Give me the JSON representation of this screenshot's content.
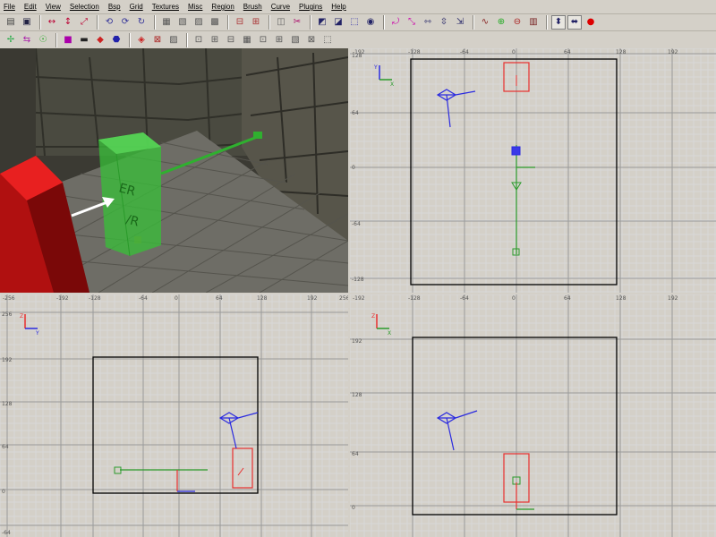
{
  "menu": [
    "File",
    "Edit",
    "View",
    "Selection",
    "Bsp",
    "Grid",
    "Textures",
    "Misc",
    "Region",
    "Brush",
    "Curve",
    "Plugins",
    "Help"
  ],
  "toolbar1_icons": [
    "open-file-icon",
    "save-icon",
    "flip-x-icon",
    "flip-y-icon",
    "flip-z-icon",
    "rotate-x-icon",
    "rotate-y-icon",
    "rotate-z-icon",
    "select-complete-icon",
    "select-touching-icon",
    "select-partial-icon",
    "select-inside-icon",
    "csg-subtract-icon",
    "csg-merge-icon",
    "hollow-icon",
    "clipper-icon",
    "change-view-icon",
    "texture-view-icon",
    "cube-clip-icon",
    "camera-mode-icon",
    "free-rotation-icon",
    "free-scale-icon",
    "scale-x-icon",
    "scale-y-icon",
    "scale-z-icon",
    "patch-bend-icon",
    "patch-insert-icon",
    "patch-delete-icon",
    "patch-icon",
    "drag-edges-icon",
    "drag-vertices-icon",
    "show-entities-icon"
  ],
  "toolbar2_icons": [
    "caulk-icon",
    "show-angles-icon",
    "show-names-icon",
    "cubic-icon",
    "camera-icon",
    "lighting-icon",
    "redisperse-icon",
    "fit-icon",
    "patch-thicken-icon",
    "patch-inspector-icon",
    "invert-curve-icon",
    "weld-icon",
    "drop-icon",
    "cap-icon",
    "texture-lock-icon",
    "texture-rotate-icon",
    "texture-scale-icon",
    "patch-cycle-icon",
    "patch-matrix-icon"
  ],
  "viewports": {
    "top": {
      "h_ticks": [
        "-192",
        "-128",
        "-64",
        "0",
        "64",
        "128",
        "192"
      ],
      "v_ticks": [
        "128",
        "64",
        "0",
        "-64",
        "-128"
      ],
      "axes": {
        "up": "Y",
        "right": "X"
      }
    },
    "side": {
      "h_ticks": [
        "-256",
        "-192",
        "-128",
        "-64",
        "0",
        "64",
        "128",
        "192",
        "256"
      ],
      "v_ticks": [
        "256",
        "192",
        "128",
        "64",
        "0",
        "-64"
      ],
      "axes": {
        "up": "Z",
        "right": "Y"
      }
    },
    "front": {
      "h_ticks": [
        "-192",
        "-128",
        "-64",
        "0",
        "64",
        "128",
        "192"
      ],
      "v_ticks": [
        "192",
        "128",
        "64",
        "0"
      ],
      "axes": {
        "up": "Z",
        "right": "X"
      }
    }
  },
  "colors": {
    "grid_minor": "#d8d8d8",
    "grid_major": "#9a9a9a",
    "brush": "#000000",
    "selected": "#e83030",
    "entity": "#2a2ae0",
    "path": "#2a9a2a",
    "viewport_bg": "#ffffff",
    "toolbar_bg": "#d4d0c8"
  }
}
